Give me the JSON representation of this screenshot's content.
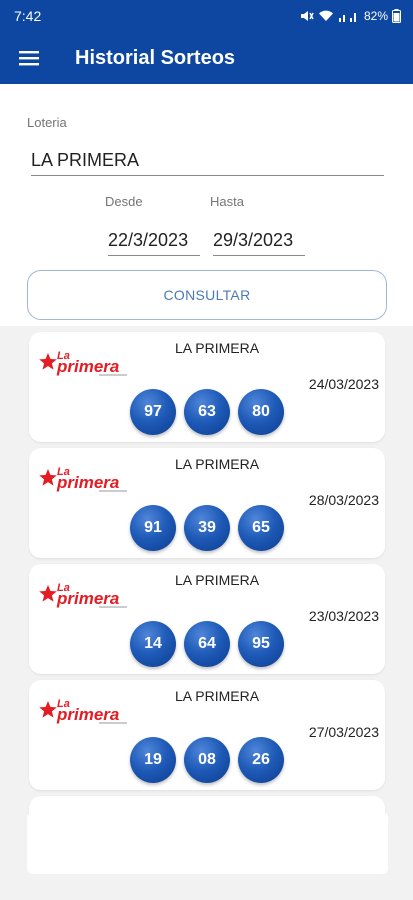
{
  "status_bar": {
    "time": "7:42",
    "battery": "82%"
  },
  "app_bar": {
    "title": "Historial Sorteos",
    "menu_icon": "hamburger-menu-icon"
  },
  "form": {
    "lottery_label": "Loteria",
    "lottery_value": "LA PRIMERA",
    "from_label": "Desde",
    "from_value": "22/3/2023",
    "to_label": "Hasta",
    "to_value": "29/3/2023",
    "submit_label": "CONSULTAR"
  },
  "results": [
    {
      "logo_text": "La primera",
      "name": "LA PRIMERA",
      "date": "24/03/2023",
      "numbers": [
        "97",
        "63",
        "80"
      ]
    },
    {
      "logo_text": "La primera",
      "name": "LA PRIMERA",
      "date": "28/03/2023",
      "numbers": [
        "91",
        "39",
        "65"
      ]
    },
    {
      "logo_text": "La primera",
      "name": "LA PRIMERA",
      "date": "23/03/2023",
      "numbers": [
        "14",
        "64",
        "95"
      ]
    },
    {
      "logo_text": "La primera",
      "name": "LA PRIMERA",
      "date": "27/03/2023",
      "numbers": [
        "19",
        "08",
        "26"
      ]
    }
  ],
  "colors": {
    "primary": "#0d47a1",
    "ball": "#1f5bb8",
    "logo_red": "#e21d24"
  }
}
